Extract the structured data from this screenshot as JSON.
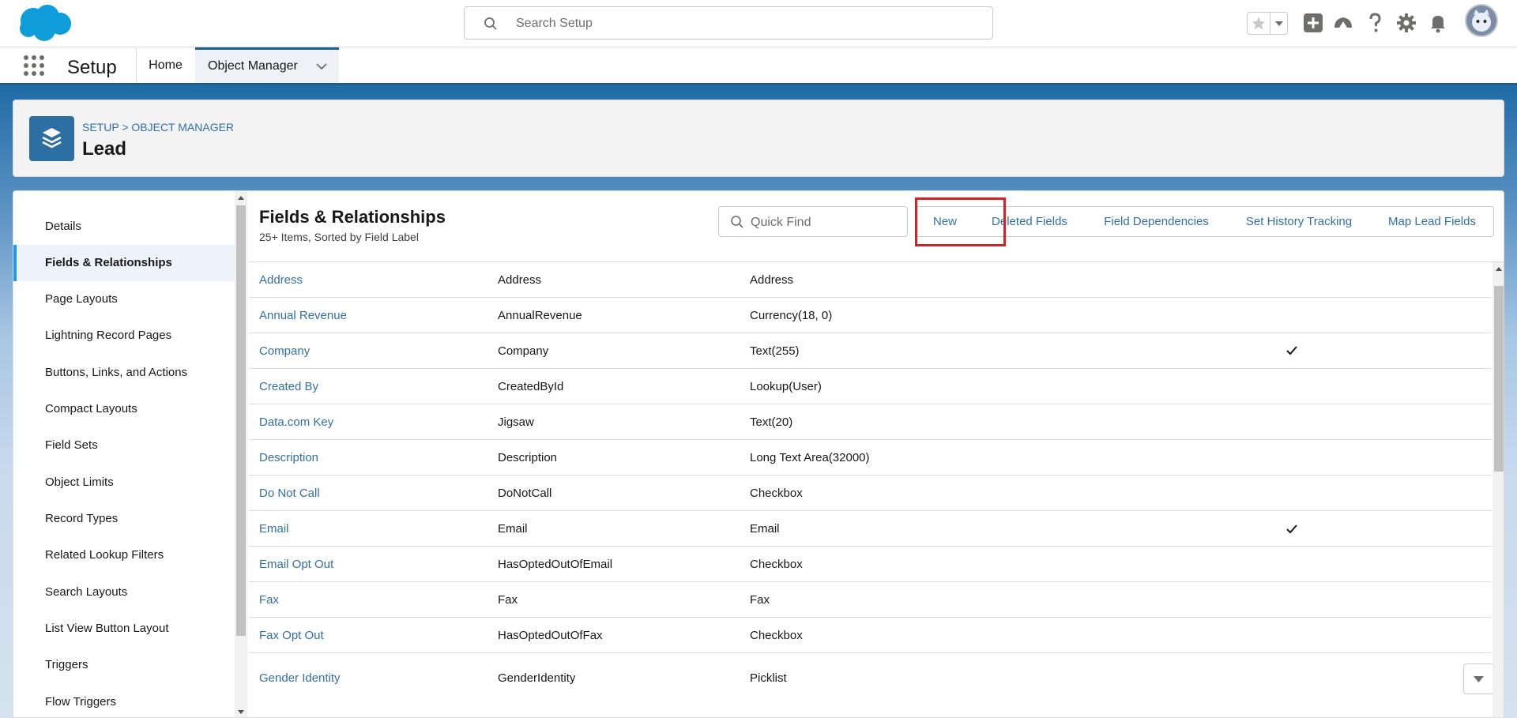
{
  "header": {
    "search_placeholder": "Search Setup"
  },
  "app_nav": {
    "app_name": "Setup",
    "tabs": [
      {
        "label": "Home"
      },
      {
        "label": "Object Manager"
      }
    ]
  },
  "object": {
    "breadcrumb": "SETUP > OBJECT MANAGER",
    "title": "Lead"
  },
  "sidebar": {
    "items": [
      {
        "label": "Details"
      },
      {
        "label": "Fields & Relationships"
      },
      {
        "label": "Page Layouts"
      },
      {
        "label": "Lightning Record Pages"
      },
      {
        "label": "Buttons, Links, and Actions"
      },
      {
        "label": "Compact Layouts"
      },
      {
        "label": "Field Sets"
      },
      {
        "label": "Object Limits"
      },
      {
        "label": "Record Types"
      },
      {
        "label": "Related Lookup Filters"
      },
      {
        "label": "Search Layouts"
      },
      {
        "label": "List View Button Layout"
      },
      {
        "label": "Triggers"
      },
      {
        "label": "Flow Triggers"
      }
    ],
    "active_index": 1
  },
  "section": {
    "title": "Fields & Relationships",
    "subtitle": "25+ Items, Sorted by Field Label",
    "quick_find_placeholder": "Quick Find",
    "buttons": {
      "new": "New",
      "deleted_fields": "Deleted Fields",
      "field_dependencies": "Field Dependencies",
      "set_history_tracking": "Set History Tracking",
      "map_lead_fields": "Map Lead Fields"
    }
  },
  "fields_table": {
    "rows": [
      {
        "label": "Address",
        "api_name": "Address",
        "type": "Address",
        "indexed": false
      },
      {
        "label": "Annual Revenue",
        "api_name": "AnnualRevenue",
        "type": "Currency(18, 0)",
        "indexed": false
      },
      {
        "label": "Company",
        "api_name": "Company",
        "type": "Text(255)",
        "indexed": true
      },
      {
        "label": "Created By",
        "api_name": "CreatedById",
        "type": "Lookup(User)",
        "indexed": false
      },
      {
        "label": "Data.com Key",
        "api_name": "Jigsaw",
        "type": "Text(20)",
        "indexed": false
      },
      {
        "label": "Description",
        "api_name": "Description",
        "type": "Long Text Area(32000)",
        "indexed": false
      },
      {
        "label": "Do Not Call",
        "api_name": "DoNotCall",
        "type": "Checkbox",
        "indexed": false
      },
      {
        "label": "Email",
        "api_name": "Email",
        "type": "Email",
        "indexed": true
      },
      {
        "label": "Email Opt Out",
        "api_name": "HasOptedOutOfEmail",
        "type": "Checkbox",
        "indexed": false
      },
      {
        "label": "Fax",
        "api_name": "Fax",
        "type": "Fax",
        "indexed": false
      },
      {
        "label": "Fax Opt Out",
        "api_name": "HasOptedOutOfFax",
        "type": "Checkbox",
        "indexed": false
      },
      {
        "label": "Gender Identity",
        "api_name": "GenderIdentity",
        "type": "Picklist",
        "indexed": false
      }
    ]
  },
  "colors": {
    "link": "#3170a7",
    "brand": "#1b5f8a",
    "highlight": "#d0242b"
  },
  "icons": [
    "salesforce-cloud-logo",
    "search-icon",
    "star-icon",
    "chevron-down-icon",
    "plus-icon",
    "trailhead-icon",
    "help-icon",
    "gear-icon",
    "bell-icon",
    "avatar",
    "app-launcher-icon",
    "object-layers-icon",
    "checkmark-icon"
  ]
}
